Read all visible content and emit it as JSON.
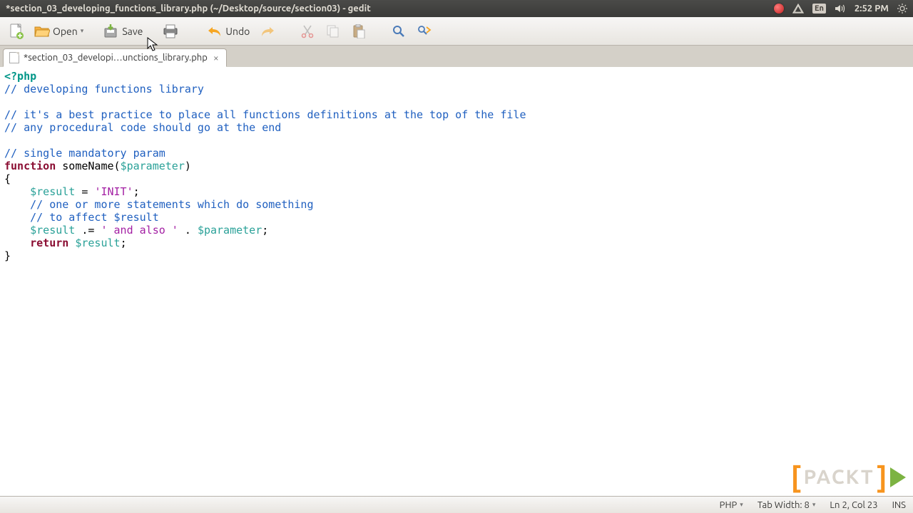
{
  "system_bar": {
    "title": "*section_03_developing_functions_library.php (~/Desktop/source/section03) - gedit",
    "lang": "En",
    "time": "2:52 PM"
  },
  "toolbar": {
    "open_label": "Open",
    "save_label": "Save",
    "undo_label": "Undo"
  },
  "tab": {
    "label": "*section_03_developi…unctions_library.php"
  },
  "code": {
    "l1_open": "<?php",
    "l2": "// developing functions library",
    "l4": "// it's a best practice to place all functions definitions at the top of the file",
    "l5": "// any procedural code should go at the end",
    "l7": "// single mandatory param",
    "l8_kw": "function",
    "l8_name": " someName(",
    "l8_param": "$parameter",
    "l8_close": ")",
    "l9": "{",
    "l10_indent": "    ",
    "l10_var": "$result",
    "l10_eq": " = ",
    "l10_str": "'INIT'",
    "l10_semi": ";",
    "l11": "    // one or more statements which do something",
    "l12": "    // to affect $result",
    "l13_indent": "    ",
    "l13_var": "$result",
    "l13_op": " .= ",
    "l13_str": "' and also '",
    "l13_dot": " . ",
    "l13_param": "$parameter",
    "l13_semi": ";",
    "l14_indent": "    ",
    "l14_kw": "return",
    "l14_sp": " ",
    "l14_var": "$result",
    "l14_semi": ";",
    "l15": "}"
  },
  "status": {
    "lang": "PHP",
    "tabwidth": "Tab Width: 8",
    "pos": "Ln 2, Col 23",
    "ins": "INS"
  }
}
